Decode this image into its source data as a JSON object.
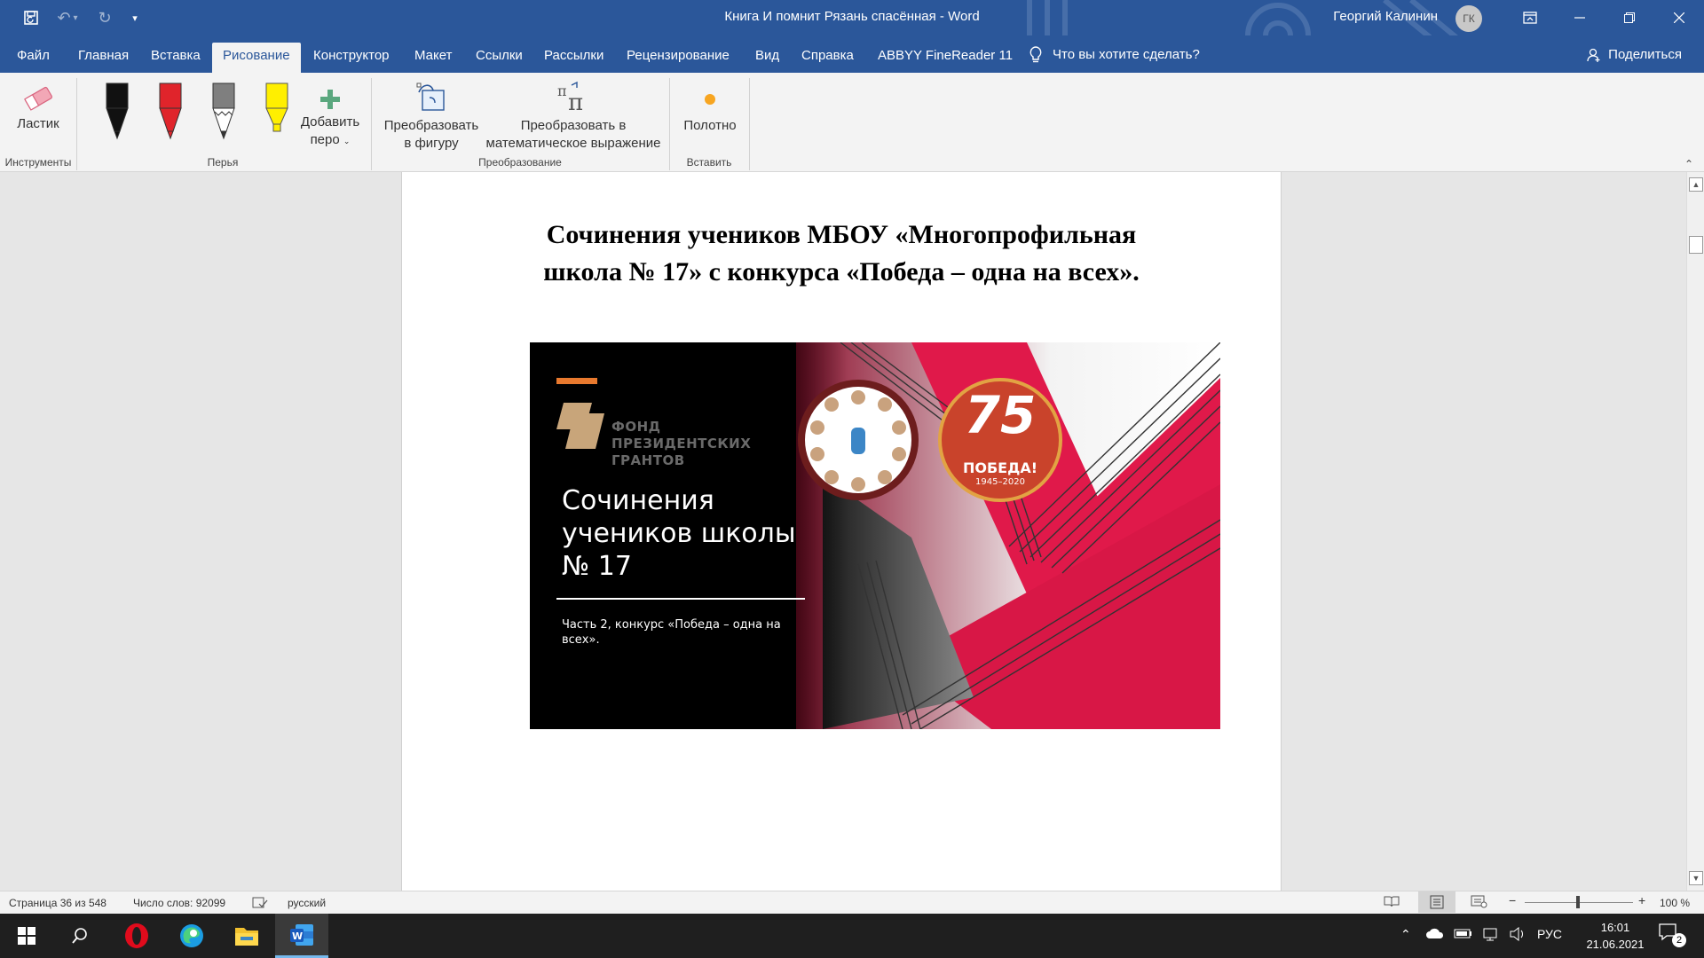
{
  "window": {
    "title": "Книга И помнит Рязань спасённая  -  Word",
    "user_name": "Георгий Калинин",
    "user_initials": "ГК"
  },
  "tabs": [
    "Файл",
    "Главная",
    "Вставка",
    "Рисование",
    "Конструктор",
    "Макет",
    "Ссылки",
    "Рассылки",
    "Рецензирование",
    "Вид",
    "Справка",
    "ABBYY FineReader 11"
  ],
  "active_tab": "Рисование",
  "tell_me": "Что вы хотите сделать?",
  "share_label": "Поделиться",
  "ribbon": {
    "eraser_label": "Ластик",
    "add_pen_label1": "Добавить",
    "add_pen_label2": "перо",
    "convert_shape1": "Преобразовать",
    "convert_shape2": "в фигуру",
    "convert_math1": "Преобразовать в",
    "convert_math2": "математическое выражение",
    "canvas_label": "Полотно",
    "groups": {
      "tools": "Инструменты",
      "pens": "Перья",
      "convert": "Преобразование",
      "insert": "Вставить"
    },
    "pen_colors": [
      "#111111",
      "#e0242b",
      "#7f7f7f",
      "#ffef00"
    ]
  },
  "document": {
    "heading_line1": "Сочинения учеников МБОУ «Многопрофильная",
    "heading_line2": "школа № 17» с конкурса «Победа – одна на всех».",
    "banner": {
      "fund_line1": "ФОНД",
      "fund_line2": "ПРЕЗИДЕНТСКИХ",
      "fund_line3": "ГРАНТОВ",
      "title_line1": "Сочинения",
      "title_line2": "учеников школы",
      "title_line3": "№ 17",
      "subtitle_line1": "Часть 2, конкурс «Победа – одна на",
      "subtitle_line2": "всех».",
      "badge_number": "75",
      "badge_text": "ПОБЕДА!",
      "badge_years": "1945–2020"
    }
  },
  "status": {
    "page": "Страница 36 из 548",
    "words": "Число слов: 92099",
    "language": "русский",
    "zoom": "100 %"
  },
  "taskbar": {
    "lang": "РУС",
    "time": "16:01",
    "date": "21.06.2021",
    "notifications": "2"
  },
  "colors": {
    "word_blue": "#2b579a",
    "accent_red": "#e0194a",
    "orange": "#e8792e"
  }
}
